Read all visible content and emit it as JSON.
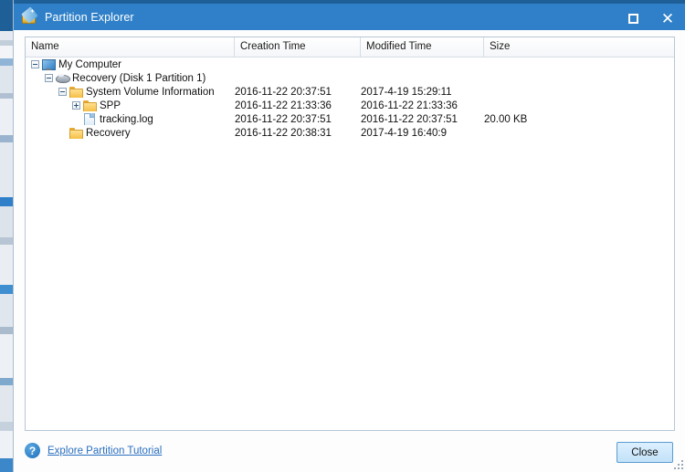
{
  "window": {
    "title": "Partition Explorer",
    "icon": "partition-wizard-icon",
    "controls": {
      "maximize": "□",
      "close": "✕"
    }
  },
  "list": {
    "columns": [
      {
        "key": "name",
        "label": "Name"
      },
      {
        "key": "created",
        "label": "Creation Time"
      },
      {
        "key": "modified",
        "label": "Modified Time"
      },
      {
        "key": "size",
        "label": "Size"
      }
    ],
    "rows": [
      {
        "name": "My Computer",
        "icon": "computer-icon",
        "expander": "minus",
        "depth": 0,
        "created": "",
        "modified": "",
        "size": ""
      },
      {
        "name": "Recovery (Disk 1 Partition 1)",
        "icon": "drive-icon",
        "expander": "minus",
        "depth": 1,
        "created": "",
        "modified": "",
        "size": ""
      },
      {
        "name": "System Volume Information",
        "icon": "folder-icon",
        "expander": "minus",
        "depth": 2,
        "created": "2016-11-22 20:37:51",
        "modified": "2017-4-19 15:29:11",
        "size": ""
      },
      {
        "name": "SPP",
        "icon": "folder-icon",
        "expander": "plus",
        "depth": 3,
        "created": "2016-11-22 21:33:36",
        "modified": "2016-11-22 21:33:36",
        "size": ""
      },
      {
        "name": "tracking.log",
        "icon": "file-icon",
        "expander": "none",
        "depth": 3,
        "created": "2016-11-22 20:37:51",
        "modified": "2016-11-22 20:37:51",
        "size": "20.00 KB"
      },
      {
        "name": "Recovery",
        "icon": "folder-icon",
        "expander": "none",
        "depth": 2,
        "created": "2016-11-22 20:38:31",
        "modified": "2017-4-19 16:40:9",
        "size": ""
      }
    ]
  },
  "footer": {
    "help_icon": "help-circle-icon",
    "help_link": "Explore Partition Tutorial",
    "close_label": "Close"
  },
  "colors": {
    "titlebar": "#2f80c8",
    "titlebar_top": "#1f5f97",
    "link": "#2a6fc0",
    "button": "#c2e2f8"
  }
}
